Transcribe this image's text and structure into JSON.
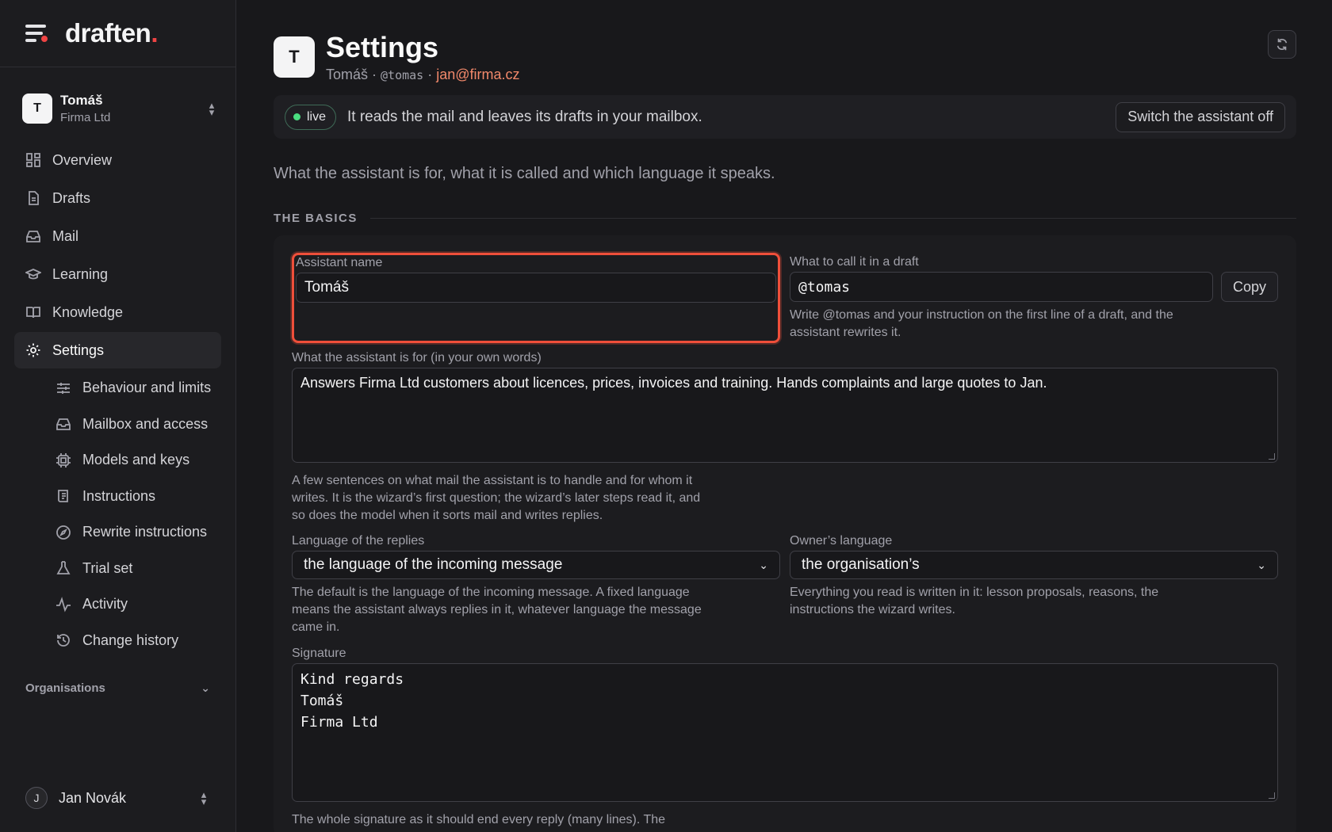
{
  "brand": {
    "name": "draften",
    "dot": "."
  },
  "org_switch": {
    "initial": "T",
    "name": "Tomáš",
    "org": "Firma Ltd"
  },
  "nav": {
    "items": [
      {
        "label": "Overview",
        "icon": "grid-icon"
      },
      {
        "label": "Drafts",
        "icon": "document-icon"
      },
      {
        "label": "Mail",
        "icon": "inbox-icon"
      },
      {
        "label": "Learning",
        "icon": "graduation-cap-icon"
      },
      {
        "label": "Knowledge",
        "icon": "book-icon"
      },
      {
        "label": "Settings",
        "icon": "gear-icon",
        "active": true
      }
    ],
    "sub_items": [
      {
        "label": "Behaviour and limits",
        "icon": "sliders-icon"
      },
      {
        "label": "Mailbox and access",
        "icon": "inbox-icon"
      },
      {
        "label": "Models and keys",
        "icon": "chip-icon"
      },
      {
        "label": "Instructions",
        "icon": "scroll-icon"
      },
      {
        "label": "Rewrite instructions",
        "icon": "compass-icon"
      },
      {
        "label": "Trial set",
        "icon": "flask-icon"
      },
      {
        "label": "Activity",
        "icon": "activity-icon"
      },
      {
        "label": "Change history",
        "icon": "history-icon"
      }
    ],
    "organisations_label": "Organisations"
  },
  "user": {
    "initial": "J",
    "name": "Jan Novák"
  },
  "header": {
    "initial": "T",
    "title": "Settings",
    "name": "Tomáš",
    "sep1": " · ",
    "handle": "@tomas",
    "sep2": " · ",
    "email": "jan@firma.cz"
  },
  "status": {
    "badge": "live",
    "text": "It reads the mail and leaves its drafts in your mailbox.",
    "button": "Switch the assistant off",
    "colors": {
      "live": "#4ade80"
    }
  },
  "intro": "What the assistant is for, what it is called and which language it speaks.",
  "section_title": "THE BASICS",
  "form": {
    "assistant_name": {
      "label": "Assistant name",
      "value": "Tomáš"
    },
    "call_name": {
      "label": "What to call it in a draft",
      "value": "@tomas",
      "button": "Copy",
      "hint": "Write @tomas and your instruction on the first line of a draft, and the assistant rewrites it."
    },
    "purpose": {
      "label": "What the assistant is for (in your own words)",
      "value": "Answers Firma Ltd customers about licences, prices, invoices and training. Hands complaints and large quotes to Jan.",
      "hint": "A few sentences on what mail the assistant is to handle and for whom it writes. It is the wizard’s first question; the wizard’s later steps read it, and so does the model when it sorts mail and writes replies."
    },
    "reply_language": {
      "label": "Language of the replies",
      "value": "the language of the incoming message",
      "hint": "The default is the language of the incoming message. A fixed language means the assistant always replies in it, whatever language the message came in."
    },
    "owner_language": {
      "label": "Owner’s language",
      "value": "the organisation’s",
      "hint": "Everything you read is written in it: lesson proposals, reasons, the instructions the wizard writes."
    },
    "signature": {
      "label": "Signature",
      "lines": [
        "Kind regards",
        "Tomáš",
        "Firma Ltd"
      ],
      "hint": "The whole signature as it should end every reply (many lines). The"
    }
  },
  "colors": {
    "accent": "#ef4f3a",
    "email": "#f2896b"
  }
}
